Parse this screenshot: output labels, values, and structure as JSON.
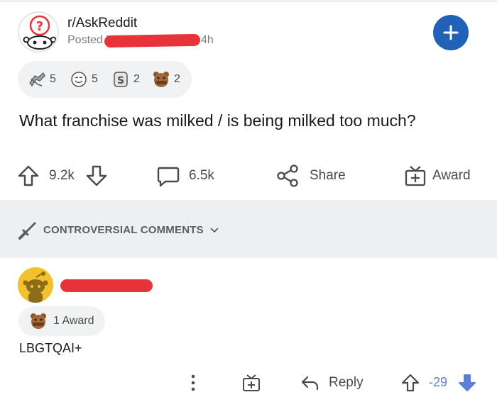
{
  "post": {
    "subreddit": "r/AskReddit",
    "posted_prefix": "Posted b",
    "age": "4h",
    "title": "What franchise was milked / is being milked too much?",
    "awards": [
      {
        "icon": "hands-award-icon",
        "count": "5"
      },
      {
        "icon": "smile-face-award-icon",
        "count": "5"
      },
      {
        "icon": "silver-coin-award-icon",
        "count": "2"
      },
      {
        "icon": "bear-award-icon",
        "count": "2"
      }
    ],
    "upvotes": "9.2k",
    "comments": "6.5k",
    "share_label": "Share",
    "award_label": "Award"
  },
  "sort": {
    "label": "CONTROVERSIAL COMMENTS"
  },
  "comment": {
    "award_label": "1 Award",
    "body": "LBGTQAI+",
    "reply_label": "Reply",
    "score": "-29"
  },
  "colors": {
    "accent_blue": "#2161b7",
    "downvote_blue": "#5a80d9",
    "redaction": "#e8333a",
    "band": "#edeff1"
  }
}
